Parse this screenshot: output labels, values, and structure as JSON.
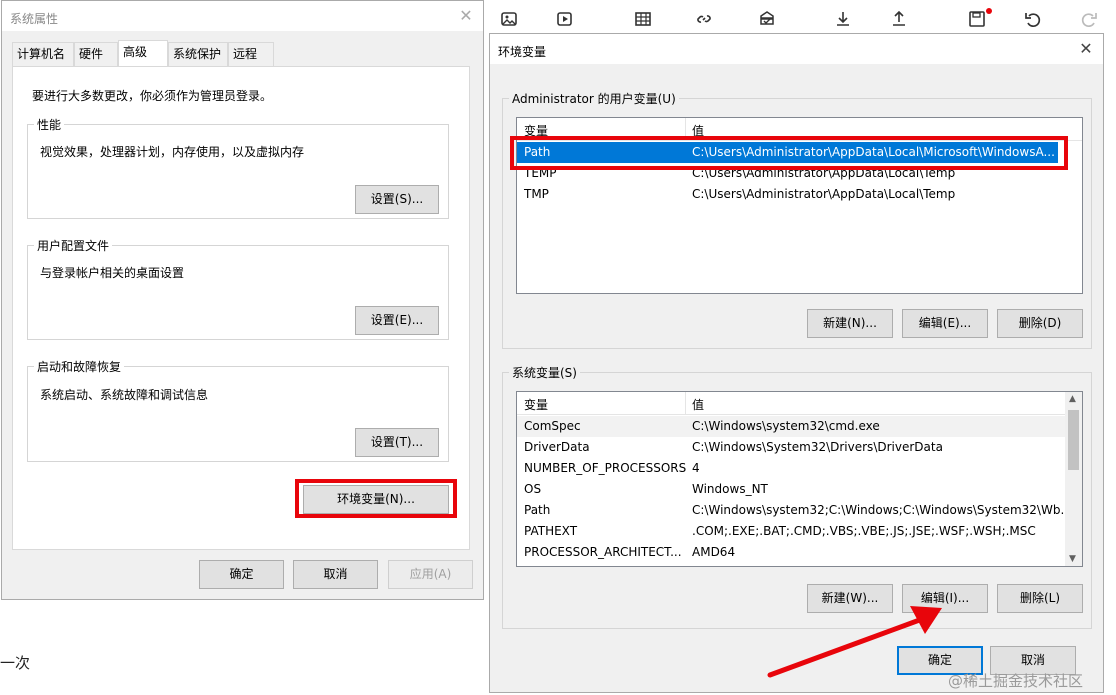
{
  "colors": {
    "accent": "#0078d7",
    "highlight_red": "#e8050b"
  },
  "background": {
    "toolbar_icons": [
      "image-icon",
      "video-icon",
      "table-icon",
      "link-icon",
      "stamp-icon",
      "download-icon",
      "upload-icon",
      "save-icon",
      "undo-icon",
      "redo-icon"
    ],
    "left_text": "一次",
    "watermark": "@稀土掘金技术社区"
  },
  "sysprops": {
    "title": "系统属性",
    "tabs": [
      "计算机名",
      "硬件",
      "高级",
      "系统保护",
      "远程"
    ],
    "active_tab": "高级",
    "admin_note": "要进行大多数更改，你必须作为管理员登录。",
    "groups": [
      {
        "label": "性能",
        "desc": "视觉效果，处理器计划，内存使用，以及虚拟内存",
        "button": "设置(S)..."
      },
      {
        "label": "用户配置文件",
        "desc": "与登录帐户相关的桌面设置",
        "button": "设置(E)..."
      },
      {
        "label": "启动和故障恢复",
        "desc": "系统启动、系统故障和调试信息",
        "button": "设置(T)..."
      }
    ],
    "env_button": "环境变量(N)...",
    "ok": "确定",
    "cancel": "取消",
    "apply": "应用(A)"
  },
  "envvars": {
    "title": "环境变量",
    "user_section": "Administrator 的用户变量(U)",
    "col_var": "变量",
    "col_val": "值",
    "user_rows": [
      {
        "name": "Path",
        "value": "C:\\Users\\Administrator\\AppData\\Local\\Microsoft\\WindowsA..."
      },
      {
        "name": "TEMP",
        "value": "C:\\Users\\Administrator\\AppData\\Local\\Temp"
      },
      {
        "name": "TMP",
        "value": "C:\\Users\\Administrator\\AppData\\Local\\Temp"
      }
    ],
    "user_buttons": {
      "new": "新建(N)...",
      "edit": "编辑(E)...",
      "delete": "删除(D)"
    },
    "sys_section": "系统变量(S)",
    "sys_rows": [
      {
        "name": "ComSpec",
        "value": "C:\\Windows\\system32\\cmd.exe"
      },
      {
        "name": "DriverData",
        "value": "C:\\Windows\\System32\\Drivers\\DriverData"
      },
      {
        "name": "NUMBER_OF_PROCESSORS",
        "value": "4"
      },
      {
        "name": "OS",
        "value": "Windows_NT"
      },
      {
        "name": "Path",
        "value": "C:\\Windows\\system32;C:\\Windows;C:\\Windows\\System32\\Wb..."
      },
      {
        "name": "PATHEXT",
        "value": ".COM;.EXE;.BAT;.CMD;.VBS;.VBE;.JS;.JSE;.WSF;.WSH;.MSC"
      },
      {
        "name": "PROCESSOR_ARCHITECT...",
        "value": "AMD64"
      }
    ],
    "sys_buttons": {
      "new": "新建(W)...",
      "edit": "编辑(I)...",
      "delete": "删除(L)"
    },
    "ok": "确定",
    "cancel": "取消"
  }
}
